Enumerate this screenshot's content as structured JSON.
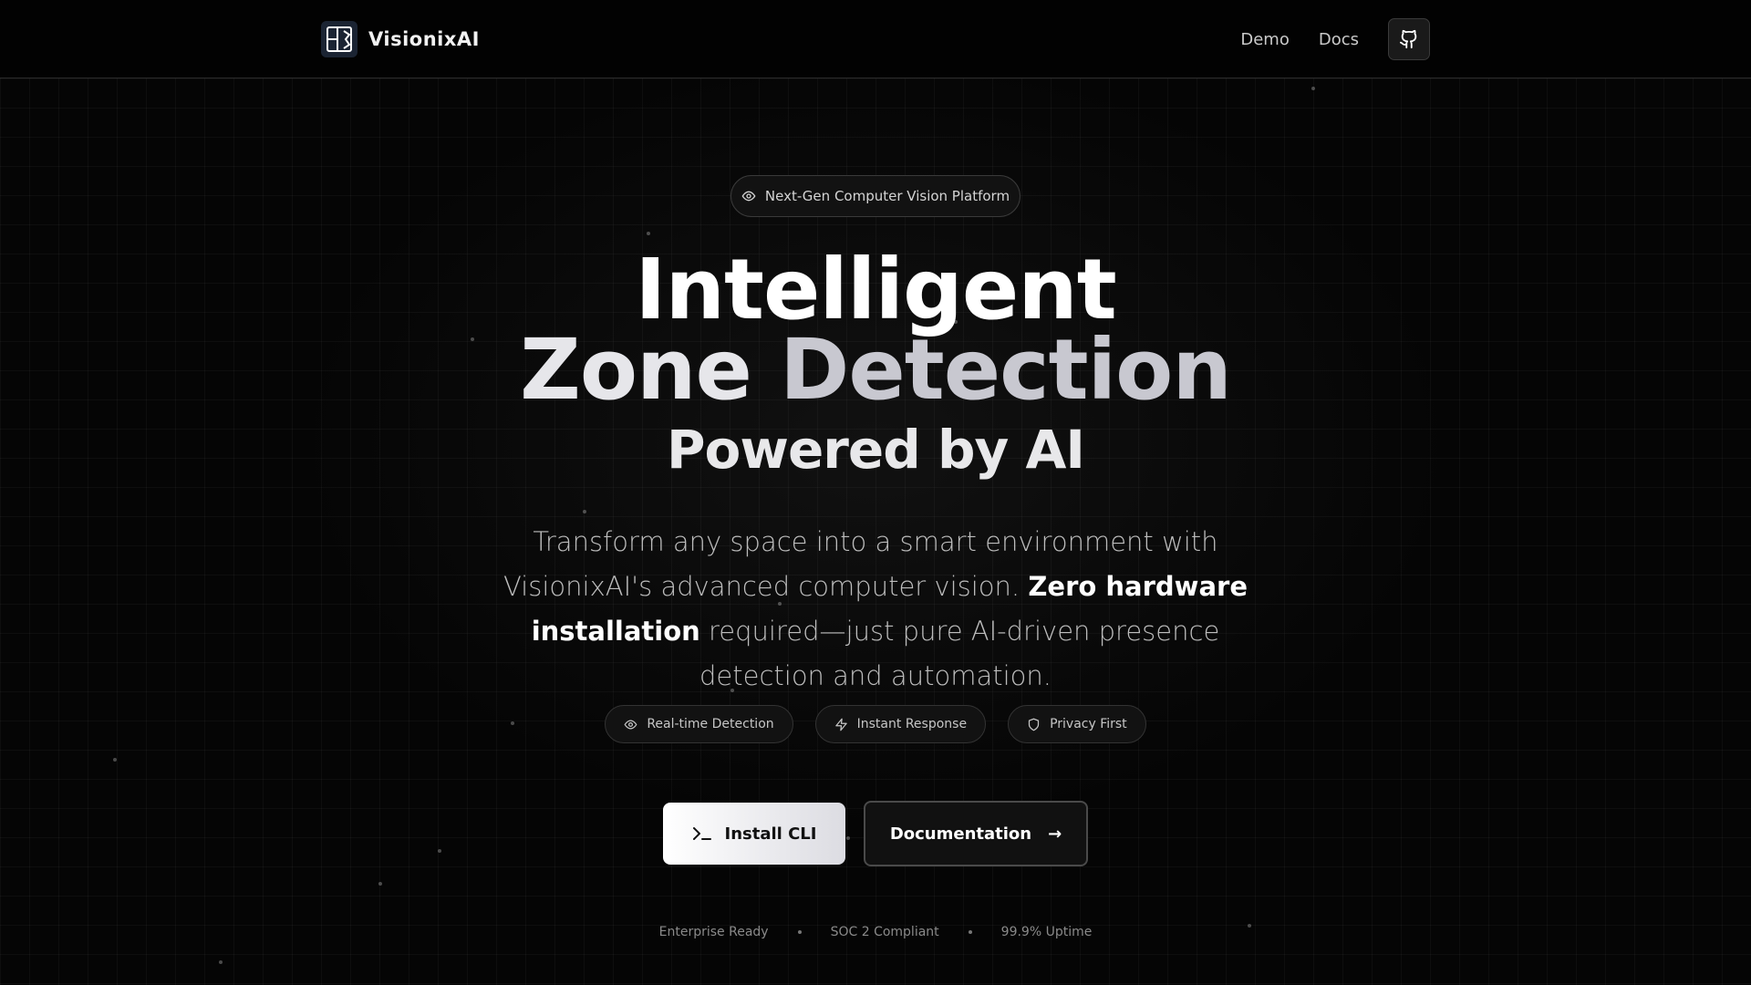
{
  "header": {
    "brand": "VisionixAI",
    "nav": [
      {
        "label": "Demo"
      },
      {
        "label": "Docs"
      }
    ],
    "github_icon": "github-icon"
  },
  "hero": {
    "badge": "Next-Gen Computer Vision Platform",
    "title_line1": "Intelligent",
    "title_line2_a": "Zone",
    "title_line2_b": "Detection",
    "title_line3": "Powered by AI",
    "lead_part1": "Transform any space into a smart environment with VisionixAI's advanced computer vision.",
    "lead_strong": "Zero hardware installation",
    "lead_part2": "required—just pure AI-driven presence detection and automation."
  },
  "features": [
    {
      "label": "Real-time Detection",
      "icon": "eye-icon"
    },
    {
      "label": "Instant Response",
      "icon": "bolt-icon"
    },
    {
      "label": "Privacy First",
      "icon": "shield-icon"
    }
  ],
  "ctas": {
    "primary": "Install CLI",
    "secondary": "Documentation",
    "secondary_arrow": "→"
  },
  "trust": [
    "Enterprise Ready",
    "SOC 2 Compliant",
    "99.9% Uptime"
  ]
}
